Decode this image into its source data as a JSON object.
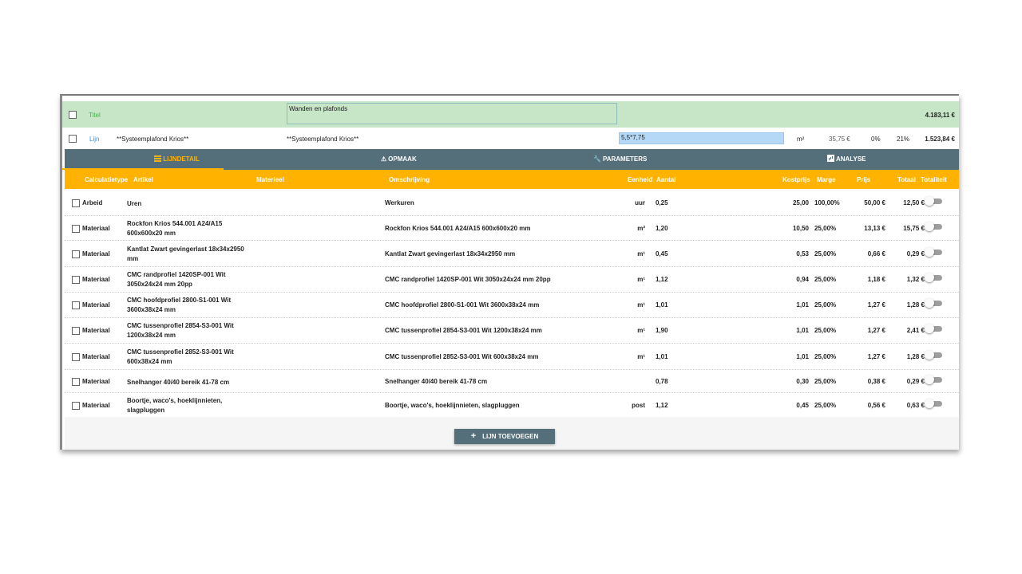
{
  "title_row": {
    "type": "Titel",
    "value": "Wanden en plafonds",
    "amount": "4.183,11 €"
  },
  "line_row": {
    "type": "Lijn",
    "artikel": "**Systeemplafond Krios**",
    "omschrijving": "**Systeemplafond Krios**",
    "quantity": "5,5*7,75",
    "unit": "m²",
    "cost": "35,75 €",
    "margin": "0%",
    "vat": "21%",
    "total": "1.523,84 €"
  },
  "tabs": {
    "lijndetail": "LIJNDETAIL",
    "opmaak": "OPMAAK",
    "parameters": "PARAMETERS",
    "analyse": "ANALYSE",
    "active": "lijndetail"
  },
  "header": {
    "calculatietype": "Calculatietype",
    "artikel": "Artikel",
    "materieel": "Materieel",
    "omschrijving": "Omschrijving",
    "eenheid": "Eenheid",
    "aantal": "Aantal",
    "kostprijs": "Kostprijs",
    "marge": "Marge",
    "prijs": "Prijs",
    "totaal": "Totaal",
    "totaliteit": "Totaliteit"
  },
  "rows": [
    {
      "type": "Arbeid",
      "artikel": "Uren",
      "omschrijving": "Werkuren",
      "eenheid": "uur",
      "aantal": "0,25",
      "kostprijs": "25,00",
      "marge": "100,00%",
      "prijs": "50,00 €",
      "totaal": "12,50 €"
    },
    {
      "type": "Materiaal",
      "artikel": "Rockfon Krios 544.001 A24/A15 600x600x20 mm",
      "omschrijving": "Rockfon Krios 544.001 A24/A15 600x600x20 mm",
      "eenheid": "m²",
      "aantal": "1,20",
      "kostprijs": "10,50",
      "marge": "25,00%",
      "prijs": "13,13 €",
      "totaal": "15,75 €"
    },
    {
      "type": "Materiaal",
      "artikel": "Kantlat Zwart gevingerlast 18x34x2950 mm",
      "omschrijving": "Kantlat Zwart gevingerlast 18x34x2950 mm",
      "eenheid": "m¹",
      "aantal": "0,45",
      "kostprijs": "0,53",
      "marge": "25,00%",
      "prijs": "0,66 €",
      "totaal": "0,29 €"
    },
    {
      "type": "Materiaal",
      "artikel": "CMC randprofiel 1420SP-001 Wit 3050x24x24 mm 20pp",
      "omschrijving": "CMC randprofiel 1420SP-001 Wit 3050x24x24 mm 20pp",
      "eenheid": "m¹",
      "aantal": "1,12",
      "kostprijs": "0,94",
      "marge": "25,00%",
      "prijs": "1,18 €",
      "totaal": "1,32 €"
    },
    {
      "type": "Materiaal",
      "artikel": "CMC hoofdprofiel 2800-S1-001 Wit 3600x38x24 mm",
      "omschrijving": "CMC hoofdprofiel 2800-S1-001 Wit 3600x38x24 mm",
      "eenheid": "m¹",
      "aantal": "1,01",
      "kostprijs": "1,01",
      "marge": "25,00%",
      "prijs": "1,27 €",
      "totaal": "1,28 €"
    },
    {
      "type": "Materiaal",
      "artikel": "CMC tussenprofiel 2854-S3-001 Wit 1200x38x24 mm",
      "omschrijving": "CMC tussenprofiel 2854-S3-001 Wit 1200x38x24 mm",
      "eenheid": "m¹",
      "aantal": "1,90",
      "kostprijs": "1,01",
      "marge": "25,00%",
      "prijs": "1,27 €",
      "totaal": "2,41 €"
    },
    {
      "type": "Materiaal",
      "artikel": "CMC tussenprofiel 2852-S3-001 Wit 600x38x24 mm",
      "omschrijving": "CMC tussenprofiel 2852-S3-001 Wit 600x38x24 mm",
      "eenheid": "m¹",
      "aantal": "1,01",
      "kostprijs": "1,01",
      "marge": "25,00%",
      "prijs": "1,27 €",
      "totaal": "1,28 €"
    },
    {
      "type": "Materiaal",
      "artikel": "Snelhanger 40/40 bereik 41-78 cm",
      "omschrijving": "Snelhanger 40/40 bereik 41-78 cm",
      "eenheid": "",
      "aantal": "0,78",
      "kostprijs": "0,30",
      "marge": "25,00%",
      "prijs": "0,38 €",
      "totaal": "0,29 €"
    },
    {
      "type": "Materiaal",
      "artikel": "Boortje, waco's, hoeklijnnieten, slagpluggen",
      "omschrijving": "Boortje, waco's, hoeklijnnieten, slagpluggen",
      "eenheid": "post",
      "aantal": "1,12",
      "kostprijs": "0,45",
      "marge": "25,00%",
      "prijs": "0,56 €",
      "totaal": "0,63 €"
    }
  ],
  "add_button": {
    "icon": "plus-icon",
    "label": "LIJN TOEVOEGEN"
  },
  "colors": {
    "title_bg": "#c7e5c7",
    "tabs_bg": "#546e7a",
    "header_bg": "#ffb300",
    "accent": "#ffb300",
    "line_type": "#2196f3",
    "title_type": "#4caf50",
    "quantity_bg": "#b4d8f5"
  }
}
